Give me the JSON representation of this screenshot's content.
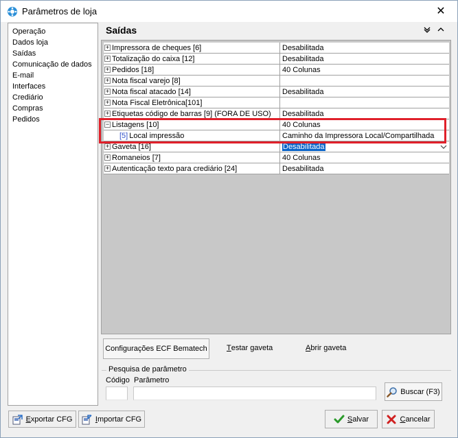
{
  "window": {
    "title": "Parâmetros de loja",
    "close_glyph": "✕"
  },
  "sidebar": {
    "items": [
      {
        "label": "Operação"
      },
      {
        "label": "Dados loja"
      },
      {
        "label": "Saídas"
      },
      {
        "label": "Comunicação de dados"
      },
      {
        "label": "E-mail"
      },
      {
        "label": "Interfaces"
      },
      {
        "label": "Crediário"
      },
      {
        "label": "Compras"
      },
      {
        "label": "Pedidos"
      }
    ]
  },
  "panel": {
    "title": "Saídas"
  },
  "grid": {
    "rows": [
      {
        "expander": "+",
        "name": "Impressora de cheques [6]",
        "value": "Desabilitada"
      },
      {
        "expander": "+",
        "name": "Totalização do caixa [12]",
        "value": "Desabilitada"
      },
      {
        "expander": "+",
        "name": "Pedidos [18]",
        "value": "40 Colunas"
      },
      {
        "expander": "+",
        "name": "Nota fiscal varejo [8]",
        "value": ""
      },
      {
        "expander": "+",
        "name": "Nota fiscal atacado [14]",
        "value": "Desabilitada"
      },
      {
        "expander": "+",
        "name": "Nota Fiscal Eletrônica[101]",
        "value": ""
      },
      {
        "expander": "+",
        "name": "Etiquetas código de barras [9] (FORA DE USO)",
        "value": "Desabilitada"
      },
      {
        "expander": "−",
        "name": "Listagens [10]",
        "value": "40 Colunas"
      },
      {
        "child_num": "[5]",
        "name": "Local impressão",
        "value": "Caminho da Impressora Local/Compartilhada"
      },
      {
        "expander": "+",
        "name": "Gaveta [16]",
        "value": "Desabilitada"
      },
      {
        "expander": "+",
        "name": "Romaneios [7]",
        "value": "40 Colunas"
      },
      {
        "expander": "+",
        "name": "Autenticação texto para crediário [24]",
        "value": "Desabilitada"
      }
    ]
  },
  "actions": {
    "ecf_label": "Configurações ECF Bematech",
    "testar_hotkey": "T",
    "testar_rest": "estar gaveta",
    "abrir_hotkey": "A",
    "abrir_rest": "brir gaveta"
  },
  "search": {
    "legend": "Pesquisa de parâmetro",
    "codigo_label": "Código",
    "parametro_label": "Parâmetro",
    "codigo_value": "",
    "parametro_value": "",
    "buscar_label": "Buscar (F3)"
  },
  "footer": {
    "exportar_hotkey": "E",
    "exportar_rest": "xportar CFG",
    "importar_hotkey": "I",
    "importar_rest": "mportar CFG",
    "salvar_hotkey": "S",
    "salvar_rest": "alvar",
    "cancelar_hotkey": "C",
    "cancelar_rest": "ancelar"
  },
  "colors": {
    "highlight_border": "#e0202a",
    "selection": "#0a64c8",
    "child_num": "#2f4fc8"
  }
}
